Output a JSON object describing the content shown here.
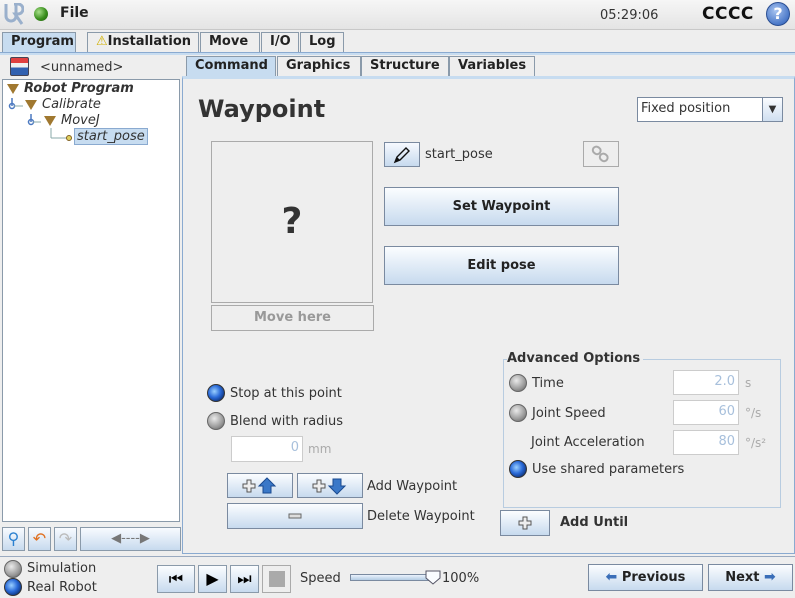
{
  "titlebar": {
    "file_menu": "File",
    "clock": "05:29:06",
    "robot_name": "CCCC",
    "help": "?"
  },
  "main_tabs": [
    {
      "label": "Program",
      "active": true
    },
    {
      "label": "Installation",
      "warning": true
    },
    {
      "label": "Move"
    },
    {
      "label": "I/O"
    },
    {
      "label": "Log"
    }
  ],
  "program": {
    "name": "<unnamed>",
    "tree": [
      {
        "label": "Robot Program",
        "level": 0
      },
      {
        "label": "Calibrate",
        "level": 1
      },
      {
        "label": "MoveJ",
        "level": 2
      },
      {
        "label": "start_pose",
        "level": 3,
        "selected": true
      }
    ]
  },
  "sub_tabs": [
    {
      "label": "Command",
      "active": true
    },
    {
      "label": "Graphics"
    },
    {
      "label": "Structure"
    },
    {
      "label": "Variables"
    }
  ],
  "waypoint": {
    "title": "Waypoint",
    "position_type": "Fixed position",
    "preview_placeholder": "?",
    "move_here": "Move here",
    "name": "start_pose",
    "set_waypoint": "Set Waypoint",
    "edit_pose": "Edit pose",
    "stop_at_point": "Stop at this point",
    "blend_with_radius": "Blend with radius",
    "blend_radius_value": "0",
    "blend_radius_unit": "mm",
    "add_waypoint": "Add Waypoint",
    "delete_waypoint": "Delete Waypoint",
    "motion_mode": "stop"
  },
  "advanced": {
    "title": "Advanced Options",
    "time_label": "Time",
    "time_value": "2.0",
    "time_unit": "s",
    "joint_speed_label": "Joint Speed",
    "joint_speed_value": "60",
    "joint_speed_unit": "°/s",
    "joint_accel_label": "Joint Acceleration",
    "joint_accel_value": "80",
    "joint_accel_unit": "°/s²",
    "shared_label": "Use shared parameters",
    "selected": "shared",
    "add_until": "Add Until"
  },
  "bottom": {
    "simulation": "Simulation",
    "real_robot": "Real Robot",
    "mode": "real",
    "speed_label": "Speed",
    "speed_percent": 100,
    "speed_text": "100%",
    "previous": "Previous",
    "next": "Next"
  }
}
